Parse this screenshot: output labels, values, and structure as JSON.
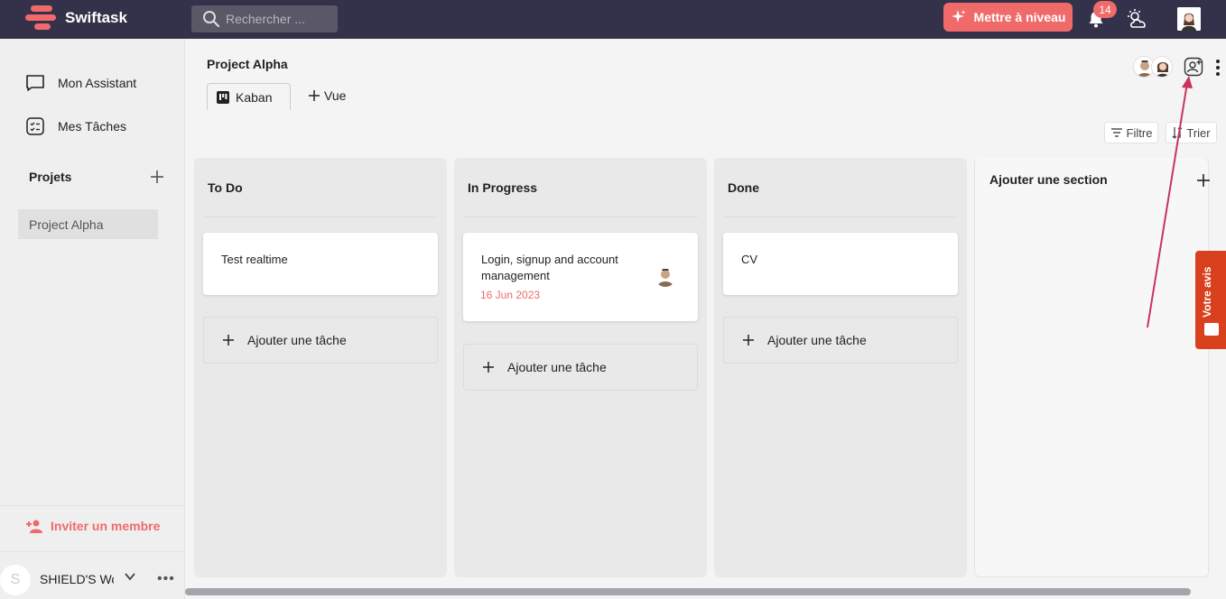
{
  "topbar": {
    "app_name": "Swiftask",
    "search_placeholder": "Rechercher ...",
    "upgrade_label": "Mettre à niveau",
    "notifications_count": "14"
  },
  "sidebar": {
    "items": [
      {
        "label": "Mon Assistant",
        "icon": "chat-icon"
      },
      {
        "label": "Mes Tâches",
        "icon": "checklist-icon"
      }
    ],
    "projects_title": "Projets",
    "projects": [
      "Project Alpha"
    ],
    "invite_label": "Inviter un membre",
    "workspace_initial": "S",
    "workspace_name": "SHIELD'S Workspace"
  },
  "header": {
    "project_title": "Project Alpha",
    "tabs": [
      {
        "label": "Kaban"
      }
    ],
    "add_view_label": "Vue",
    "filter_label": "Filtre",
    "sort_label": "Trier"
  },
  "board": {
    "columns": [
      {
        "title": "To Do",
        "cards": [
          {
            "title": "Test realtime"
          }
        ],
        "add_label": "Ajouter une tâche"
      },
      {
        "title": "In Progress",
        "cards": [
          {
            "title": "Login, signup and account management",
            "date": "16 Jun 2023"
          }
        ],
        "add_label": "Ajouter une tâche"
      },
      {
        "title": "Done",
        "cards": [
          {
            "title": "CV"
          }
        ],
        "add_label": "Ajouter une tâche"
      }
    ],
    "add_section_label": "Ajouter une section"
  },
  "feedback": {
    "label": "Votre avis"
  },
  "colors": {
    "topbar_bg": "#34314a",
    "accent": "#f06a6a",
    "feedback_bg": "#d9411e",
    "arrow": "#c8335f"
  }
}
